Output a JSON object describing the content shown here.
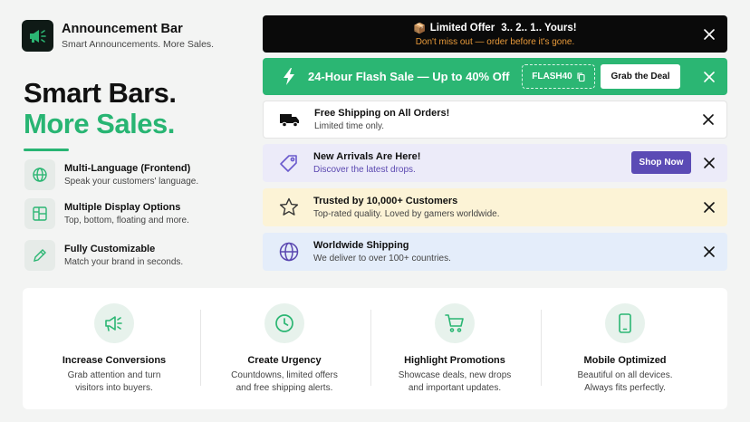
{
  "brand": {
    "title": "Announcement Bar",
    "subtitle": "Smart Announcements. More Sales.",
    "icon": "megaphone-icon"
  },
  "hero": {
    "line1": "Smart Bars.",
    "line2": "More Sales."
  },
  "features": [
    {
      "title": "Multi-Language (Frontend)",
      "subtitle": "Speak your customers' language.",
      "icon": "globe-icon"
    },
    {
      "title": "Multiple Display Options",
      "subtitle": "Top, bottom, floating and more.",
      "icon": "layout-icon"
    },
    {
      "title": "Fully Customizable",
      "subtitle": "Match your brand in seconds.",
      "icon": "pen-icon"
    }
  ],
  "bars": {
    "countdown": {
      "emoji": "📦",
      "title": "Limited Offer",
      "countdown": "3.. 2.. 1.. Yours!",
      "subtitle": "Don't miss out — order before it's gone."
    },
    "flash": {
      "title": "24-Hour Flash Sale — Up to 40% Off",
      "code": "FLASH40",
      "button": "Grab the Deal"
    },
    "shipping": {
      "title": "Free Shipping on All Orders!",
      "subtitle": "Limited time only.",
      "icon": "truck-icon"
    },
    "arrivals": {
      "title": "New Arrivals Are Here!",
      "subtitle": "Discover the latest drops.",
      "button": "Shop Now",
      "icon": "tag-icon"
    },
    "trusted": {
      "title": "Trusted by 10,000+ Customers",
      "subtitle": "Top-rated quality. Loved by gamers worldwide.",
      "icon": "star-icon"
    },
    "worldwide": {
      "title": "Worldwide Shipping",
      "subtitle": "We deliver to over 100+ countries.",
      "icon": "globe-icon"
    }
  },
  "benefits": [
    {
      "title": "Increase Conversions",
      "line1": "Grab attention and turn",
      "line2": "visitors into buyers.",
      "icon": "megaphone-icon"
    },
    {
      "title": "Create Urgency",
      "line1": "Countdowns, limited offers",
      "line2": "and free shipping alerts.",
      "icon": "clock-icon"
    },
    {
      "title": "Highlight Promotions",
      "line1": "Showcase deals, new drops",
      "line2": "and important updates.",
      "icon": "cart-icon"
    },
    {
      "title": "Mobile Optimized",
      "line1": "Beautiful on all devices.",
      "line2": "Always fits perfectly.",
      "icon": "phone-icon"
    }
  ],
  "colors": {
    "brand_green": "#2bb673",
    "black_bar": "#0a0a0a",
    "countdown_orange": "#e89a3a",
    "purple_button": "#5b4bb5",
    "lavender_bar": "#ecebf9",
    "cream_bar": "#fcf3d6",
    "blue_bar": "#e4edfa"
  }
}
